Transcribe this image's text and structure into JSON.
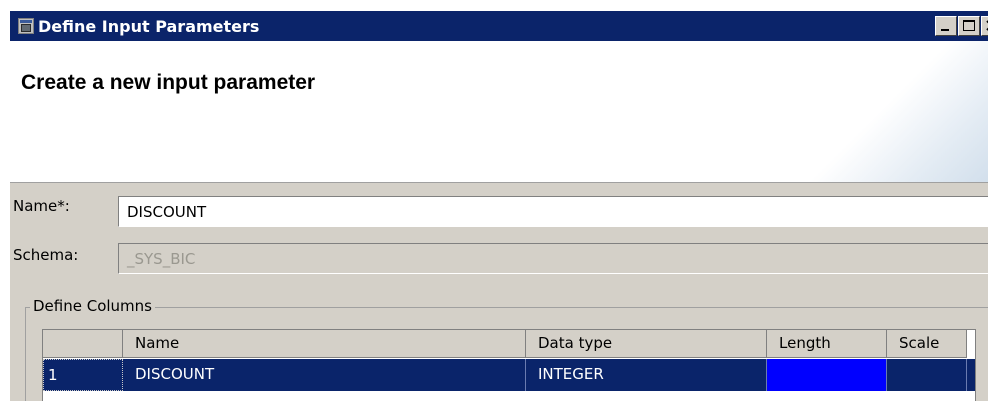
{
  "window": {
    "title": "Define Input Parameters"
  },
  "banner": {
    "heading": "Create a new input parameter"
  },
  "form": {
    "name_label": "Name*:",
    "name_value": "DISCOUNT",
    "schema_label": "Schema:",
    "schema_value": "_SYS_BIC"
  },
  "columns_group": {
    "legend": "Define Columns",
    "headers": [
      "",
      "Name",
      "Data type",
      "Length",
      "Scale"
    ],
    "rows": [
      {
        "num": "1",
        "name": "DISCOUNT",
        "data_type": "INTEGER",
        "length": "",
        "scale": ""
      }
    ]
  },
  "icons": {
    "title_icon": "app-window-icon",
    "minimize": "minimize-icon",
    "maximize": "maximize-icon",
    "close": "close-icon"
  },
  "colors": {
    "titlebar": "#0b246a",
    "selection": "#0a246a",
    "active_cell": "#0000ff",
    "dialog_face": "#d4d0c8"
  }
}
